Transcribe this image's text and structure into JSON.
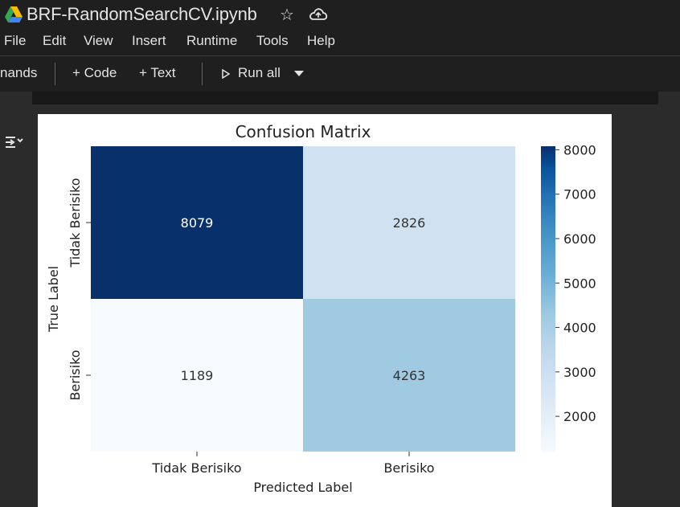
{
  "header": {
    "doc_title": "BRF-RandomSearchCV.ipynb",
    "star_icon": "star-icon",
    "cloud_icon": "cloud-sync-icon"
  },
  "menu": {
    "items": [
      "File",
      "Edit",
      "View",
      "Insert",
      "Runtime",
      "Tools",
      "Help"
    ]
  },
  "toolbar": {
    "commands_label": "nands",
    "code_label": "+ Code",
    "text_label": "+ Text",
    "run_all_label": "Run all"
  },
  "chart_data": {
    "type": "heatmap",
    "title": "Confusion Matrix",
    "xlabel": "Predicted Label",
    "ylabel": "True Label",
    "x_categories": [
      "Tidak Berisiko",
      "Berisiko"
    ],
    "y_categories": [
      "Tidak Berisiko",
      "Berisiko"
    ],
    "values": [
      [
        8079,
        2826
      ],
      [
        1189,
        4263
      ]
    ],
    "colorbar": {
      "ticks": [
        2000,
        3000,
        4000,
        5000,
        6000,
        7000,
        8000
      ],
      "min": 1189,
      "max": 8079,
      "colormap": "Blues"
    }
  }
}
